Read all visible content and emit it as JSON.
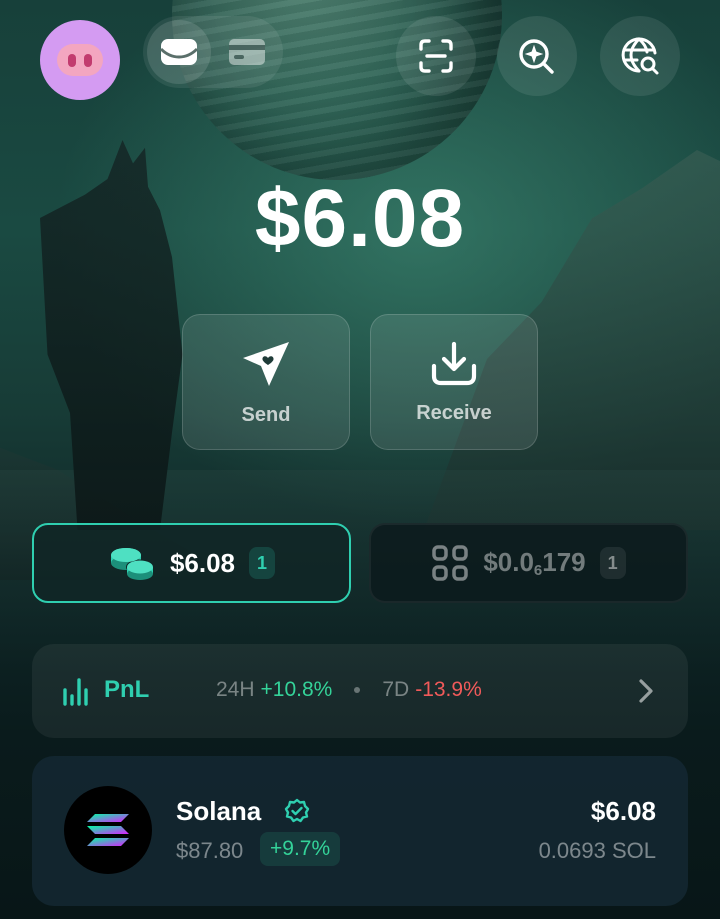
{
  "header": {
    "avatar_icon": "pig-avatar-icon",
    "view_options": [
      {
        "icon": "wallet-icon",
        "active": true
      },
      {
        "icon": "card-icon",
        "active": false
      }
    ],
    "actions": [
      {
        "icon": "scan-icon"
      },
      {
        "icon": "search-sparkle-icon"
      },
      {
        "icon": "globe-search-icon"
      }
    ]
  },
  "balance": {
    "total": "$6.08"
  },
  "actions": {
    "send_label": "Send",
    "receive_label": "Receive"
  },
  "tabs": {
    "tokens": {
      "amount": "$6.08",
      "count": "1"
    },
    "collectibles": {
      "amount_prefix": "$0.0",
      "amount_sub": "6",
      "amount_suffix": "179",
      "count": "1"
    }
  },
  "pnl": {
    "label": "PnL",
    "period_24h": "24H",
    "change_24h": "+10.8%",
    "period_7d": "7D",
    "change_7d": "-13.9%"
  },
  "tokens": [
    {
      "name": "Solana",
      "verified": true,
      "price": "$87.80",
      "change": "+9.7%",
      "value": "$6.08",
      "amount": "0.0693 SOL"
    }
  ],
  "colors": {
    "accent": "#2fcfb0",
    "positive": "#34d399",
    "negative": "#f15a5a",
    "avatar_bg": "#d49bf2"
  }
}
